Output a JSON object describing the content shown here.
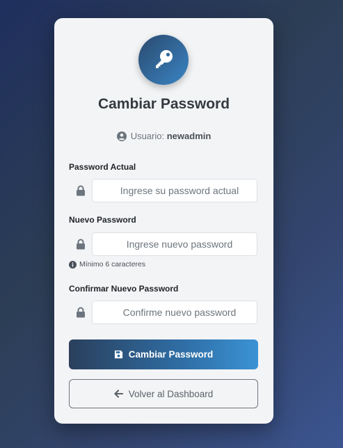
{
  "title": "Cambiar Password",
  "user": {
    "prefix": "Usuario:",
    "name": "newadmin"
  },
  "fields": [
    {
      "label": "Password Actual",
      "placeholder": "Ingrese su password actual"
    },
    {
      "label": "Nuevo Password",
      "placeholder": "Ingrese nuevo password"
    },
    {
      "label": "Confirmar Nuevo Password",
      "placeholder": "Confirme nuevo password"
    }
  ],
  "hint": "Mínimo 6 caracteres",
  "buttons": {
    "submit": "Cambiar Password",
    "back": "Volver al Dashboard"
  },
  "colors": {
    "accent_start": "#2a3f5c",
    "accent_end": "#3a92d4",
    "card": "#f3f4f6"
  },
  "icons": [
    "key-icon",
    "user-circle-icon",
    "lock-icon",
    "info-icon",
    "save-icon",
    "arrow-left-icon"
  ]
}
